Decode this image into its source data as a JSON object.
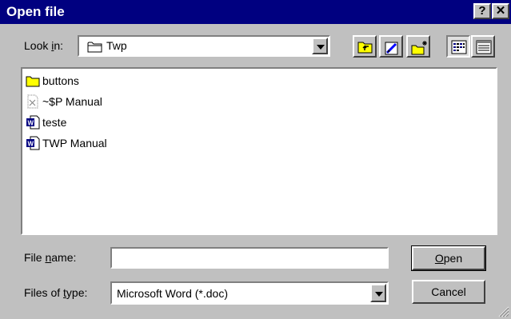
{
  "window": {
    "title": "Open file",
    "help_glyph": "?",
    "close_glyph": "✕"
  },
  "lookin": {
    "label_pre": "Look ",
    "label_ul": "i",
    "label_post": "n:",
    "value": "Twp",
    "icon": "folder-icon"
  },
  "toolbar": {
    "buttons": [
      {
        "name": "up-one-level-icon"
      },
      {
        "name": "look-in-favorites-icon"
      },
      {
        "name": "create-new-folder-icon"
      },
      {
        "name": "list-view-icon"
      },
      {
        "name": "details-view-icon"
      }
    ]
  },
  "files": [
    {
      "name": "buttons",
      "icon": "folder-icon"
    },
    {
      "name": "~$P Manual",
      "icon": "temp-document-icon"
    },
    {
      "name": "teste",
      "icon": "word-document-icon"
    },
    {
      "name": "TWP Manual",
      "icon": "word-document-icon"
    }
  ],
  "filename": {
    "label_pre": "File ",
    "label_ul": "n",
    "label_post": "ame:",
    "value": ""
  },
  "filetype": {
    "label_pre": "Files of ",
    "label_ul": "t",
    "label_post": "ype:",
    "value": "Microsoft Word (*.doc)"
  },
  "buttons": {
    "open_ul": "O",
    "open_rest": "pen",
    "cancel": "Cancel"
  },
  "colors": {
    "titlebar": "#000080",
    "face": "#c0c0c0"
  }
}
